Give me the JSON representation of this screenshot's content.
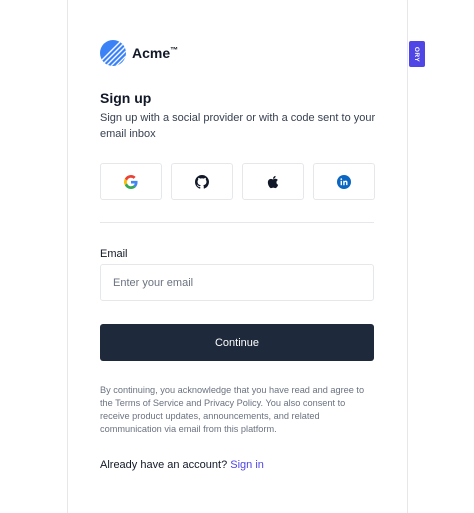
{
  "brand": {
    "name": "Acme",
    "trademark": "™",
    "logo_icon": "acme-logo-icon",
    "logo_color": "#3b82f6"
  },
  "form": {
    "title": "Sign up",
    "subtitle": "Sign up with a social provider or with a code sent to your email inbox",
    "social_providers": [
      {
        "name": "google",
        "icon": "google-icon"
      },
      {
        "name": "github",
        "icon": "github-icon"
      },
      {
        "name": "apple",
        "icon": "apple-icon"
      },
      {
        "name": "linkedin",
        "icon": "linkedin-icon"
      }
    ],
    "email_label": "Email",
    "email_placeholder": "Enter your email",
    "email_value": "",
    "continue_label": "Continue",
    "legal_text": "By continuing, you acknowledge that you have read and agree to the Terms of Service and Privacy Policy. You also consent to receive product updates, announcements, and related communication via email from this platform.",
    "signin_prompt": "Already have an account?",
    "signin_link": "Sign in"
  },
  "badge": {
    "label": "ORY",
    "color": "#4f46e5"
  },
  "colors": {
    "primary_button": "#1e293b",
    "link": "#4f46e5",
    "border": "#e5e7eb"
  }
}
